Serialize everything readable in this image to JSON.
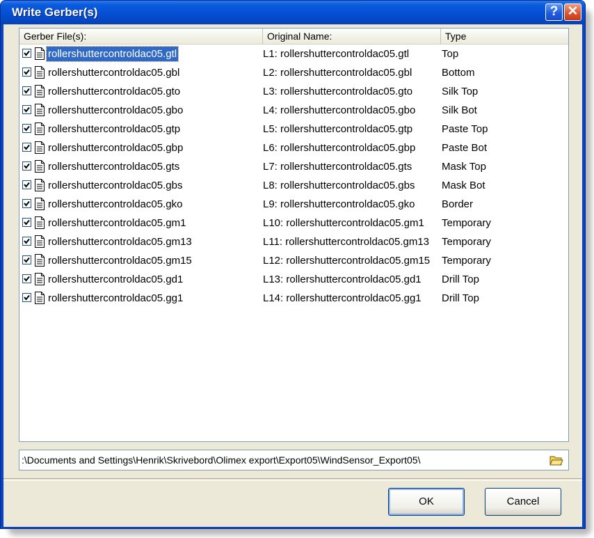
{
  "window": {
    "title": "Write Gerber(s)",
    "help_label": "?",
    "close_label": "✕"
  },
  "columns": [
    "Gerber File(s):",
    "Original Name:",
    "Type"
  ],
  "rows": [
    {
      "file": "rollershuttercontroldac05.gtl",
      "orig": "L1: rollershuttercontroldac05.gtl",
      "type": "Top",
      "checked": true,
      "selected": true
    },
    {
      "file": "rollershuttercontroldac05.gbl",
      "orig": "L2: rollershuttercontroldac05.gbl",
      "type": "Bottom",
      "checked": true
    },
    {
      "file": "rollershuttercontroldac05.gto",
      "orig": "L3: rollershuttercontroldac05.gto",
      "type": "Silk Top",
      "checked": true
    },
    {
      "file": "rollershuttercontroldac05.gbo",
      "orig": "L4: rollershuttercontroldac05.gbo",
      "type": "Silk Bot",
      "checked": true
    },
    {
      "file": "rollershuttercontroldac05.gtp",
      "orig": "L5: rollershuttercontroldac05.gtp",
      "type": "Paste Top",
      "checked": true
    },
    {
      "file": "rollershuttercontroldac05.gbp",
      "orig": "L6: rollershuttercontroldac05.gbp",
      "type": "Paste Bot",
      "checked": true
    },
    {
      "file": "rollershuttercontroldac05.gts",
      "orig": "L7: rollershuttercontroldac05.gts",
      "type": "Mask Top",
      "checked": true
    },
    {
      "file": "rollershuttercontroldac05.gbs",
      "orig": "L8: rollershuttercontroldac05.gbs",
      "type": "Mask Bot",
      "checked": true
    },
    {
      "file": "rollershuttercontroldac05.gko",
      "orig": "L9: rollershuttercontroldac05.gko",
      "type": "Border",
      "checked": true
    },
    {
      "file": "rollershuttercontroldac05.gm1",
      "orig": "L10: rollershuttercontroldac05.gm1",
      "type": "Temporary",
      "checked": true
    },
    {
      "file": "rollershuttercontroldac05.gm13",
      "orig": "L11: rollershuttercontroldac05.gm13",
      "type": "Temporary",
      "checked": true
    },
    {
      "file": "rollershuttercontroldac05.gm15",
      "orig": "L12: rollershuttercontroldac05.gm15",
      "type": "Temporary",
      "checked": true
    },
    {
      "file": "rollershuttercontroldac05.gd1",
      "orig": "L13: rollershuttercontroldac05.gd1",
      "type": "Drill Top",
      "checked": true
    },
    {
      "file": "rollershuttercontroldac05.gg1",
      "orig": "L14: rollershuttercontroldac05.gg1",
      "type": "Drill Top",
      "checked": true
    }
  ],
  "path": {
    "value": ":\\Documents and Settings\\Henrik\\Skrivebord\\Olimex export\\Export05\\WindSensor_Export05\\"
  },
  "buttons": {
    "ok": "OK",
    "cancel": "Cancel"
  },
  "icons": {
    "row_icon": "document-icon",
    "browse": "folder-open-icon"
  },
  "colors": {
    "title_blue": "#0550d6",
    "selection": "#316ac5",
    "dialog_bg": "#ece9d8"
  }
}
